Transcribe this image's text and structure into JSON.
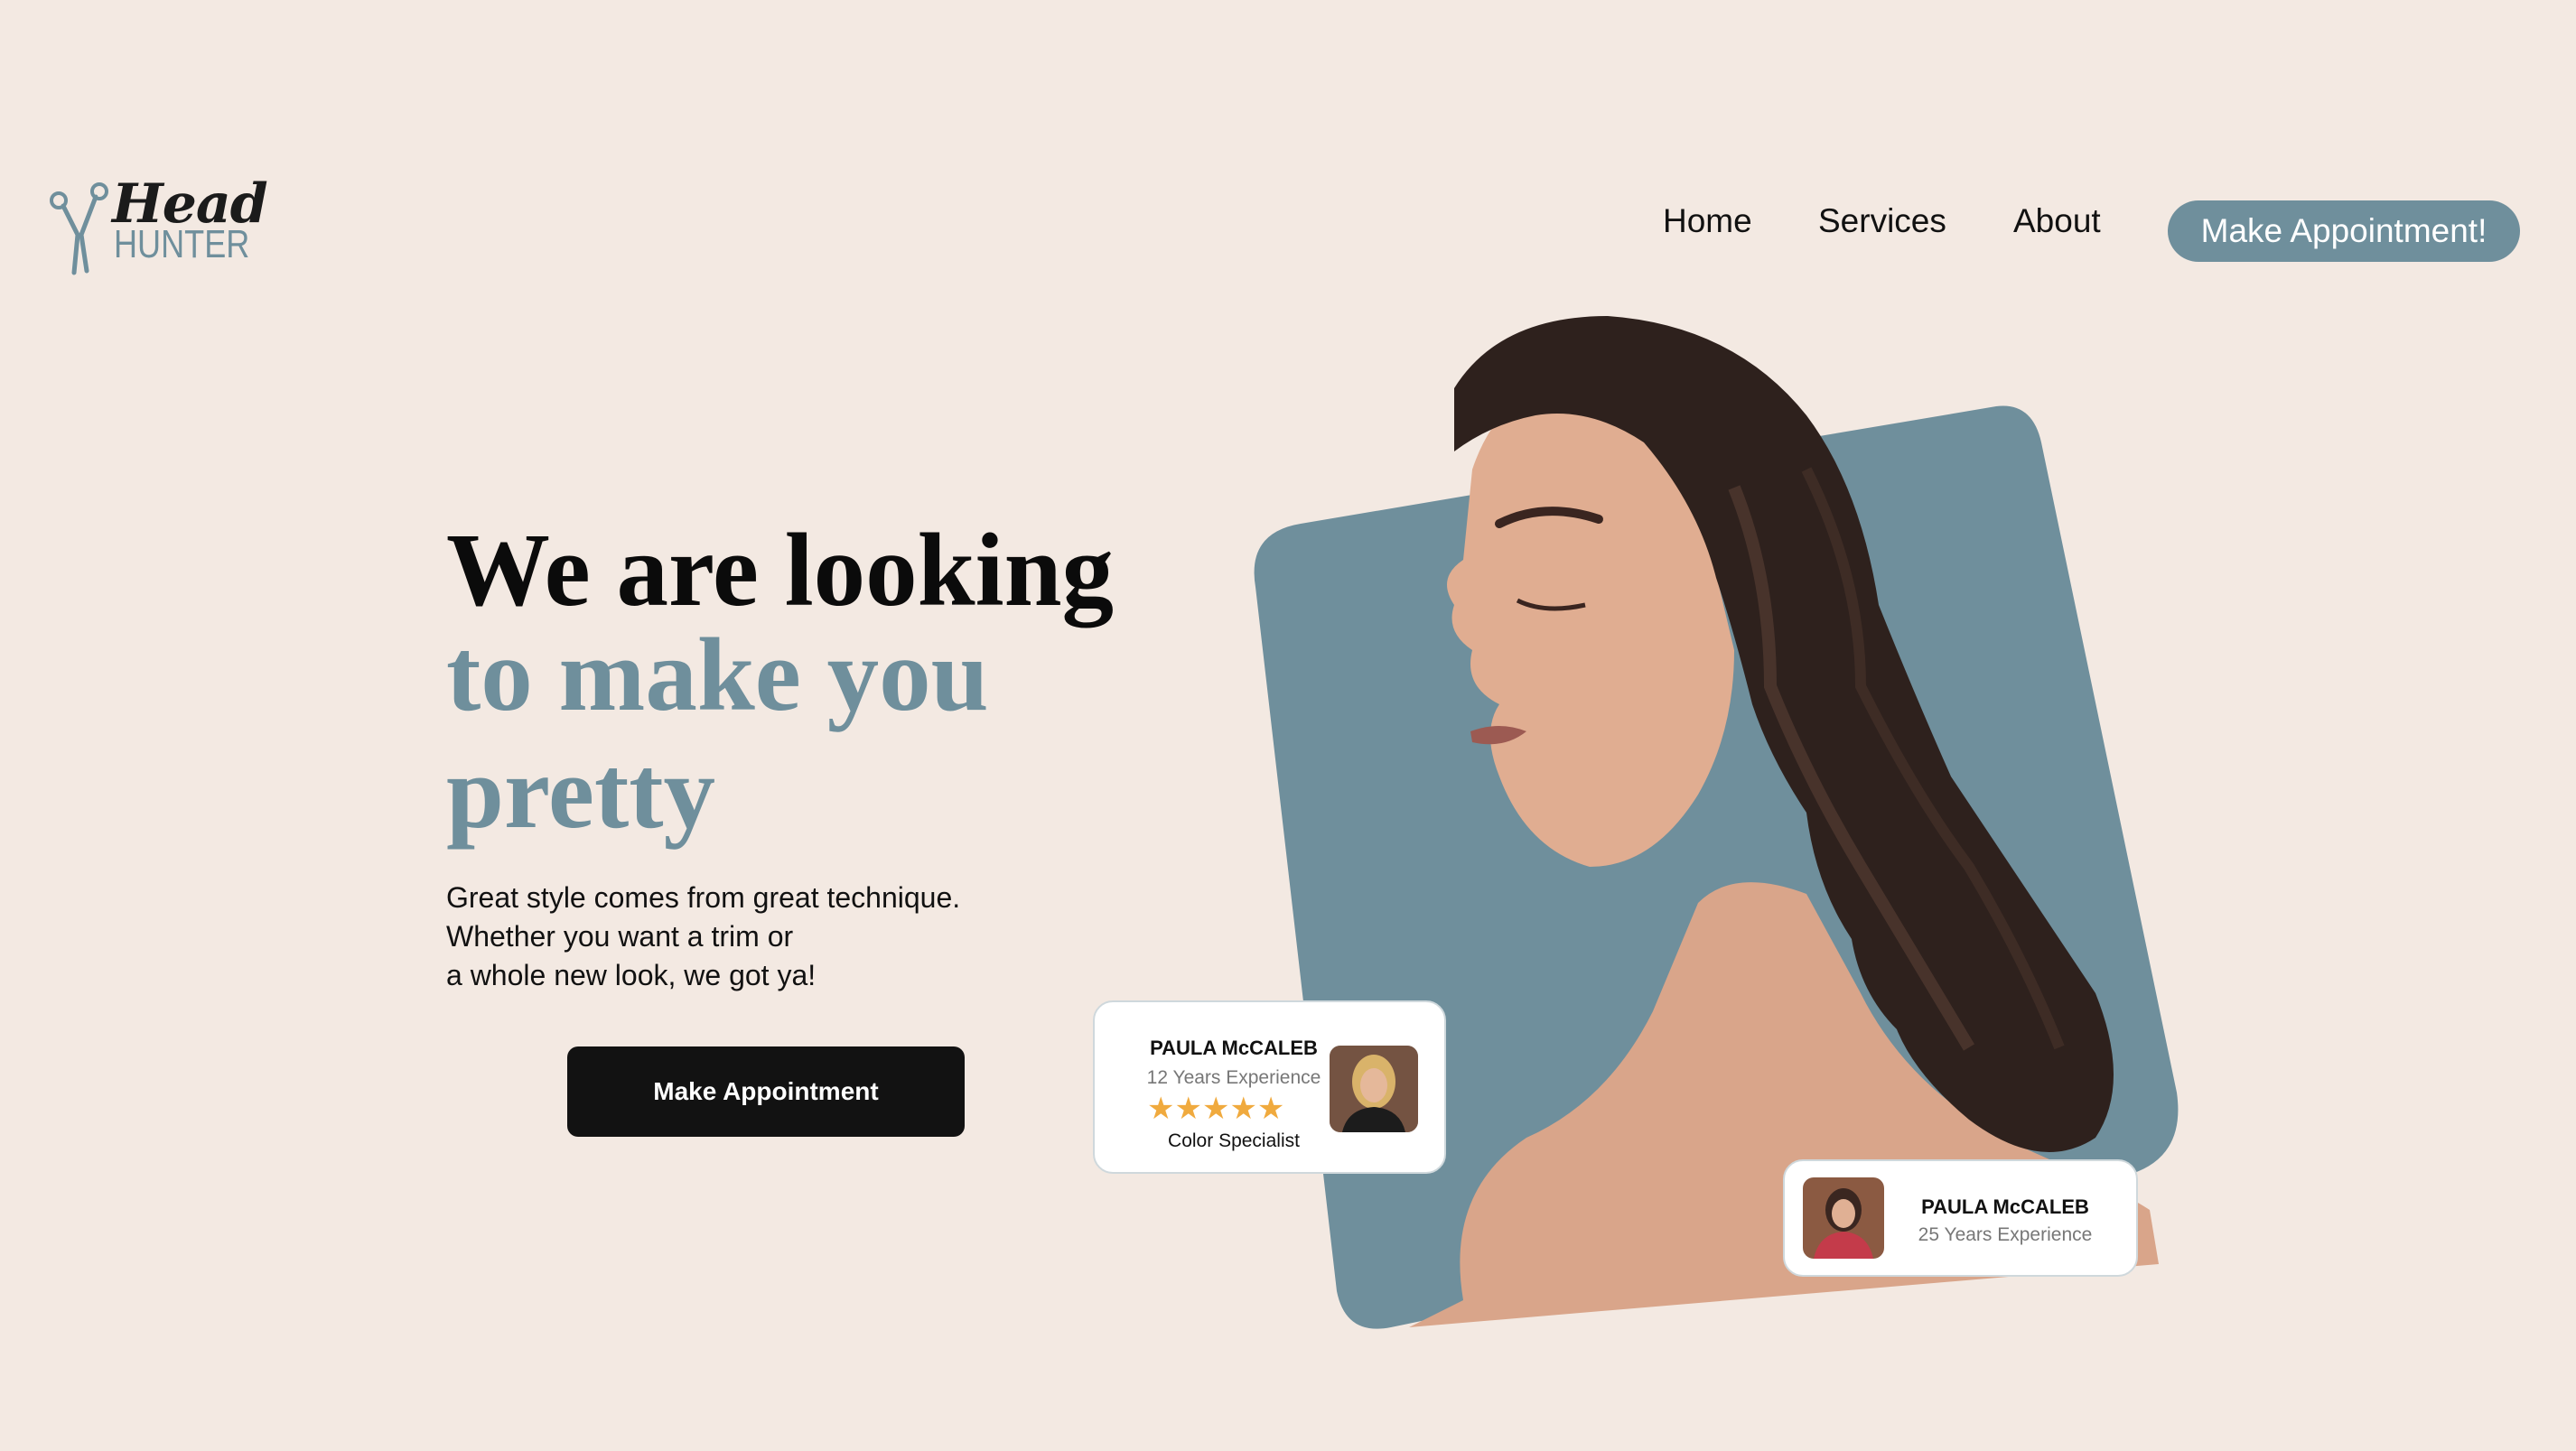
{
  "brand": {
    "line1": "Head",
    "line2": "HUNTER",
    "icon": "scissors-icon"
  },
  "nav": {
    "home": "Home",
    "services": "Services",
    "about": "About",
    "cta": "Make Appointment!"
  },
  "hero": {
    "heading_line1": "We are looking",
    "heading_line2": "to make you",
    "heading_line3": "pretty",
    "subtitle_line1": "Great style comes from great technique.",
    "subtitle_line2": "Whether you want a trim or",
    "subtitle_line3": "a whole new look, we got ya!",
    "button": "Make Appointment"
  },
  "cards": [
    {
      "name": "PAULA McCALEB",
      "experience": "12 Years Experience",
      "rating": 5,
      "stars": "★★★★★",
      "role": "Color Specialist"
    },
    {
      "name": "PAULA McCALEB",
      "experience": "25 Years Experience"
    }
  ],
  "colors": {
    "background": "#f3e9e2",
    "accent": "#6f8f9c",
    "dark_button": "#121212",
    "star": "#f0aa3e"
  }
}
